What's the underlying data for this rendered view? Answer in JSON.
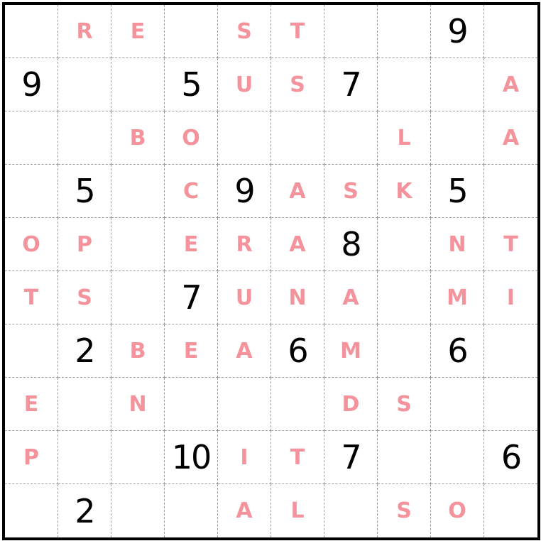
{
  "puzzle": {
    "colors": {
      "number": "#000000",
      "letter": "#f4939c",
      "border": "#000000",
      "gridline": "#9a9a9a"
    },
    "rows": [
      [
        "",
        "R",
        "E",
        "",
        "S",
        "T",
        "",
        "",
        "9",
        ""
      ],
      [
        "9",
        "",
        "",
        "5",
        "U",
        "S",
        "7",
        "",
        "",
        "A"
      ],
      [
        "",
        "",
        "B",
        "O",
        "",
        "",
        "",
        "L",
        "",
        "A"
      ],
      [
        "",
        "5",
        "",
        "C",
        "9",
        "A",
        "S",
        "K",
        "5",
        ""
      ],
      [
        "O",
        "P",
        "",
        "E",
        "R",
        "A",
        "8",
        "",
        "N",
        "T"
      ],
      [
        "T",
        "S",
        "",
        "7",
        "U",
        "N",
        "A",
        "",
        "M",
        "I"
      ],
      [
        "",
        "2",
        "B",
        "E",
        "A",
        "6",
        "M",
        "",
        "6",
        ""
      ],
      [
        "E",
        "",
        "N",
        "",
        "",
        "",
        "D",
        "S",
        "",
        ""
      ],
      [
        "P",
        "",
        "",
        "10",
        "I",
        "T",
        "7",
        "",
        "",
        "6"
      ],
      [
        "",
        "2",
        "",
        "",
        "A",
        "L",
        "",
        "S",
        "O",
        ""
      ]
    ]
  }
}
